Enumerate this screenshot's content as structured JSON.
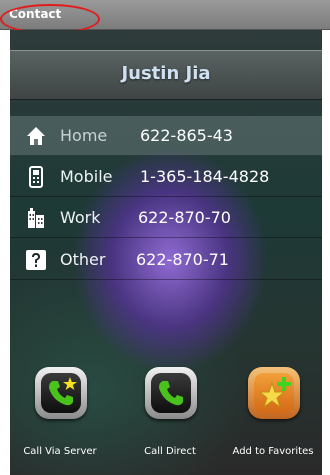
{
  "titlebar": {
    "title": "Contact"
  },
  "contact": {
    "name": "Justin Jia"
  },
  "phones": [
    {
      "type": "Home",
      "number": "622-865-43",
      "icon": "home-icon"
    },
    {
      "type": "Mobile",
      "number": "1-365-184-4828",
      "icon": "mobile-phone-icon"
    },
    {
      "type": "Work",
      "number": "622-870-70",
      "icon": "office-building-icon"
    },
    {
      "type": "Other",
      "number": "622-870-71",
      "icon": "question-mark-icon"
    }
  ],
  "actions": [
    {
      "label": "Call Via Server",
      "icon": "phone-with-star-icon"
    },
    {
      "label": "Call Direct",
      "icon": "phone-icon"
    },
    {
      "label": "Add to Favorites",
      "icon": "star-add-icon"
    }
  ],
  "colors": {
    "highlight": "#e11b1b",
    "name_text": "#cfe0f2",
    "phone_green": "#49c21b",
    "favorites_orange": "#e5811f"
  }
}
